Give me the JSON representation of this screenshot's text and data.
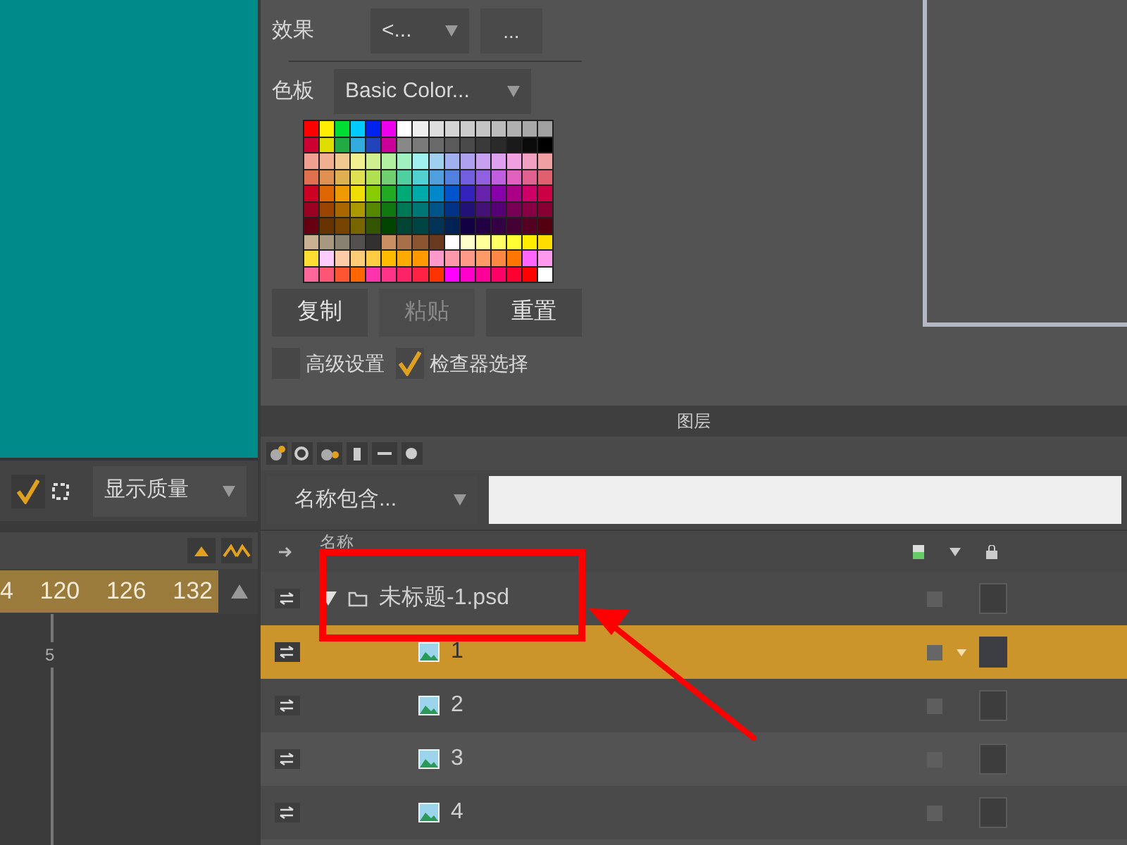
{
  "effects": {
    "label": "效果",
    "dropdown": "<...",
    "button": "..."
  },
  "swatches": {
    "label": "色板",
    "dropdown": "Basic Color..."
  },
  "swatch_buttons": [
    {
      "label": "复制",
      "disabled": false
    },
    {
      "label": "粘贴",
      "disabled": true
    },
    {
      "label": "重置",
      "disabled": false
    }
  ],
  "options": [
    {
      "label": "高级设置",
      "checked": false
    },
    {
      "label": "检查器选择",
      "checked": true
    }
  ],
  "display": {
    "checked": true,
    "dropdown": "显示质量"
  },
  "ruler": {
    "ticks": [
      "4",
      "120",
      "126",
      "132"
    ],
    "playhead": "5"
  },
  "layers": {
    "title": "图层",
    "filter": "名称包含...",
    "column": "名称",
    "items": [
      {
        "name": "未标题-1.psd",
        "kind": "folder",
        "expanded": true,
        "selected": false,
        "children": [
          {
            "name": "1",
            "kind": "image",
            "selected": true
          },
          {
            "name": "2",
            "kind": "image",
            "selected": false
          },
          {
            "name": "3",
            "kind": "image",
            "selected": false
          },
          {
            "name": "4",
            "kind": "image",
            "selected": false
          }
        ]
      }
    ]
  }
}
